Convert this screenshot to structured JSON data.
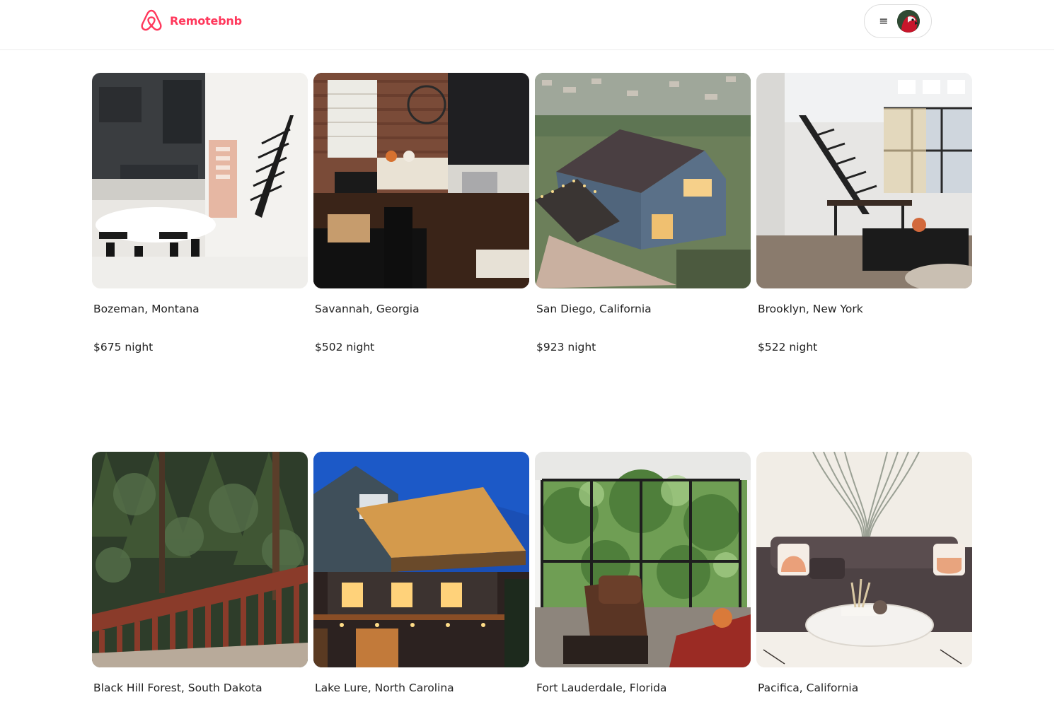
{
  "brand": {
    "name": "Remotebnb",
    "color": "#ff385c",
    "icon": "airbnb-logo-icon"
  },
  "user_menu": {
    "menu_icon": "hamburger-menu-icon",
    "menu_glyph": "≡",
    "avatar": "user-avatar"
  },
  "listings": [
    {
      "location": "Bozeman, Montana",
      "price": "$675 night",
      "photo": "modern kitchen and dining interior"
    },
    {
      "location": "Savannah, Georgia",
      "price": "$502 night",
      "photo": "brick-wall living room with kitchen"
    },
    {
      "location": "San Diego, California",
      "price": "$923 night",
      "photo": "blue hillside house at dusk"
    },
    {
      "location": "Brooklyn, New York",
      "price": "$522 night",
      "photo": "loft with spiral staircase"
    },
    {
      "location": "Black Hill Forest, South Dakota",
      "price": "",
      "photo": "wooden deck overlooking pine forest"
    },
    {
      "location": "Lake Lure, North Carolina",
      "price": "",
      "photo": "lit cabin with deck at night"
    },
    {
      "location": "Fort Lauderdale, Florida",
      "price": "",
      "photo": "leather armchair by tropical windows"
    },
    {
      "location": "Pacifica, California",
      "price": "",
      "photo": "sectional sofa with marble coffee table"
    }
  ]
}
